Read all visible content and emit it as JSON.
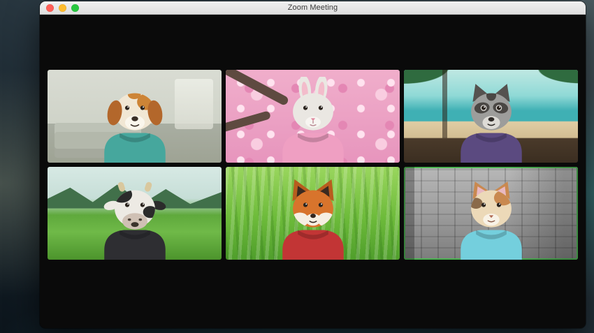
{
  "window": {
    "title": "Zoom Meeting",
    "controls": [
      {
        "name": "close",
        "color": "#ff5f57"
      },
      {
        "name": "minimize",
        "color": "#febc2e"
      },
      {
        "name": "zoom",
        "color": "#28c840"
      }
    ]
  },
  "meeting": {
    "grid": {
      "rows": 2,
      "cols": 3
    },
    "active_speaker_border": "#4db353",
    "participants": [
      {
        "id": "dog",
        "avatar": "dog-avatar",
        "scene": "home-office",
        "active": false,
        "colors": {
          "head": "#f1e7d4",
          "ears": "#b3672b",
          "patch": "#cd8436",
          "muzzle": "#faf6ec",
          "nose": "#3a2e26",
          "shirt": "#46a79d"
        }
      },
      {
        "id": "rabbit",
        "avatar": "rabbit-avatar",
        "scene": "cherry-blossom",
        "active": false,
        "colors": {
          "head": "#eae7e2",
          "ears": "#eae7e2",
          "inner_ear": "#f3bccb",
          "muzzle": "#f7f5f1",
          "nose": "#e0889e",
          "shirt": "#ef9fc2"
        }
      },
      {
        "id": "raccoon",
        "avatar": "raccoon-avatar",
        "scene": "beach",
        "active": false,
        "colors": {
          "head": "#9d9d9b",
          "ears": "#55524f",
          "mask": "#4a4744",
          "muzzle": "#dddbd6",
          "nose": "#2e2a27",
          "shirt": "#5b4a80"
        }
      },
      {
        "id": "cow",
        "avatar": "cow-avatar",
        "scene": "valley",
        "active": false,
        "colors": {
          "head": "#edeae4",
          "patch": "#2b2b2b",
          "horns": "#d9c89e",
          "muzzle": "#cfc0b4",
          "nose": "#4a4038",
          "shirt": "#2e2e32"
        }
      },
      {
        "id": "fox",
        "avatar": "fox-avatar",
        "scene": "grass",
        "active": false,
        "colors": {
          "head": "#d8742c",
          "ears": "#b85c1e",
          "cheeks": "#f6efe2",
          "muzzle": "#f6efe2",
          "nose": "#33271f",
          "shirt": "#c23535"
        }
      },
      {
        "id": "cat",
        "avatar": "cat-avatar",
        "scene": "paris",
        "active": true,
        "colors": {
          "head": "#ecd9b8",
          "patch": "#c98950",
          "ears": "#c98950",
          "muzzle": "#f8f2e6",
          "nose": "#b06a52",
          "shirt": "#74cfdd"
        }
      }
    ],
    "scenes": {
      "home-office": {
        "wall": "#d9dcd3",
        "floor": "#a9aea2",
        "furniture": "#b3b8ab"
      },
      "cherry-blossom": {
        "base": "#f0aecb",
        "light": "#ffe3ef",
        "dark": "#e487b4",
        "branch": "#5e4a40"
      },
      "beach": {
        "sky": "#bfe8e2",
        "sea": "#3fb0b4",
        "sand": "#e0cda4",
        "desk": "#4a3a2a",
        "palm": "#2f6b3f"
      },
      "valley": {
        "sky": "#d7e9e4",
        "mountain": "#41704a",
        "field": "#5fa93c"
      },
      "grass": {
        "light": "#9ad65e",
        "dark": "#4f9e2b"
      },
      "paris": {
        "light": "#b8b8b8",
        "dark": "#7d7d7d"
      }
    }
  }
}
